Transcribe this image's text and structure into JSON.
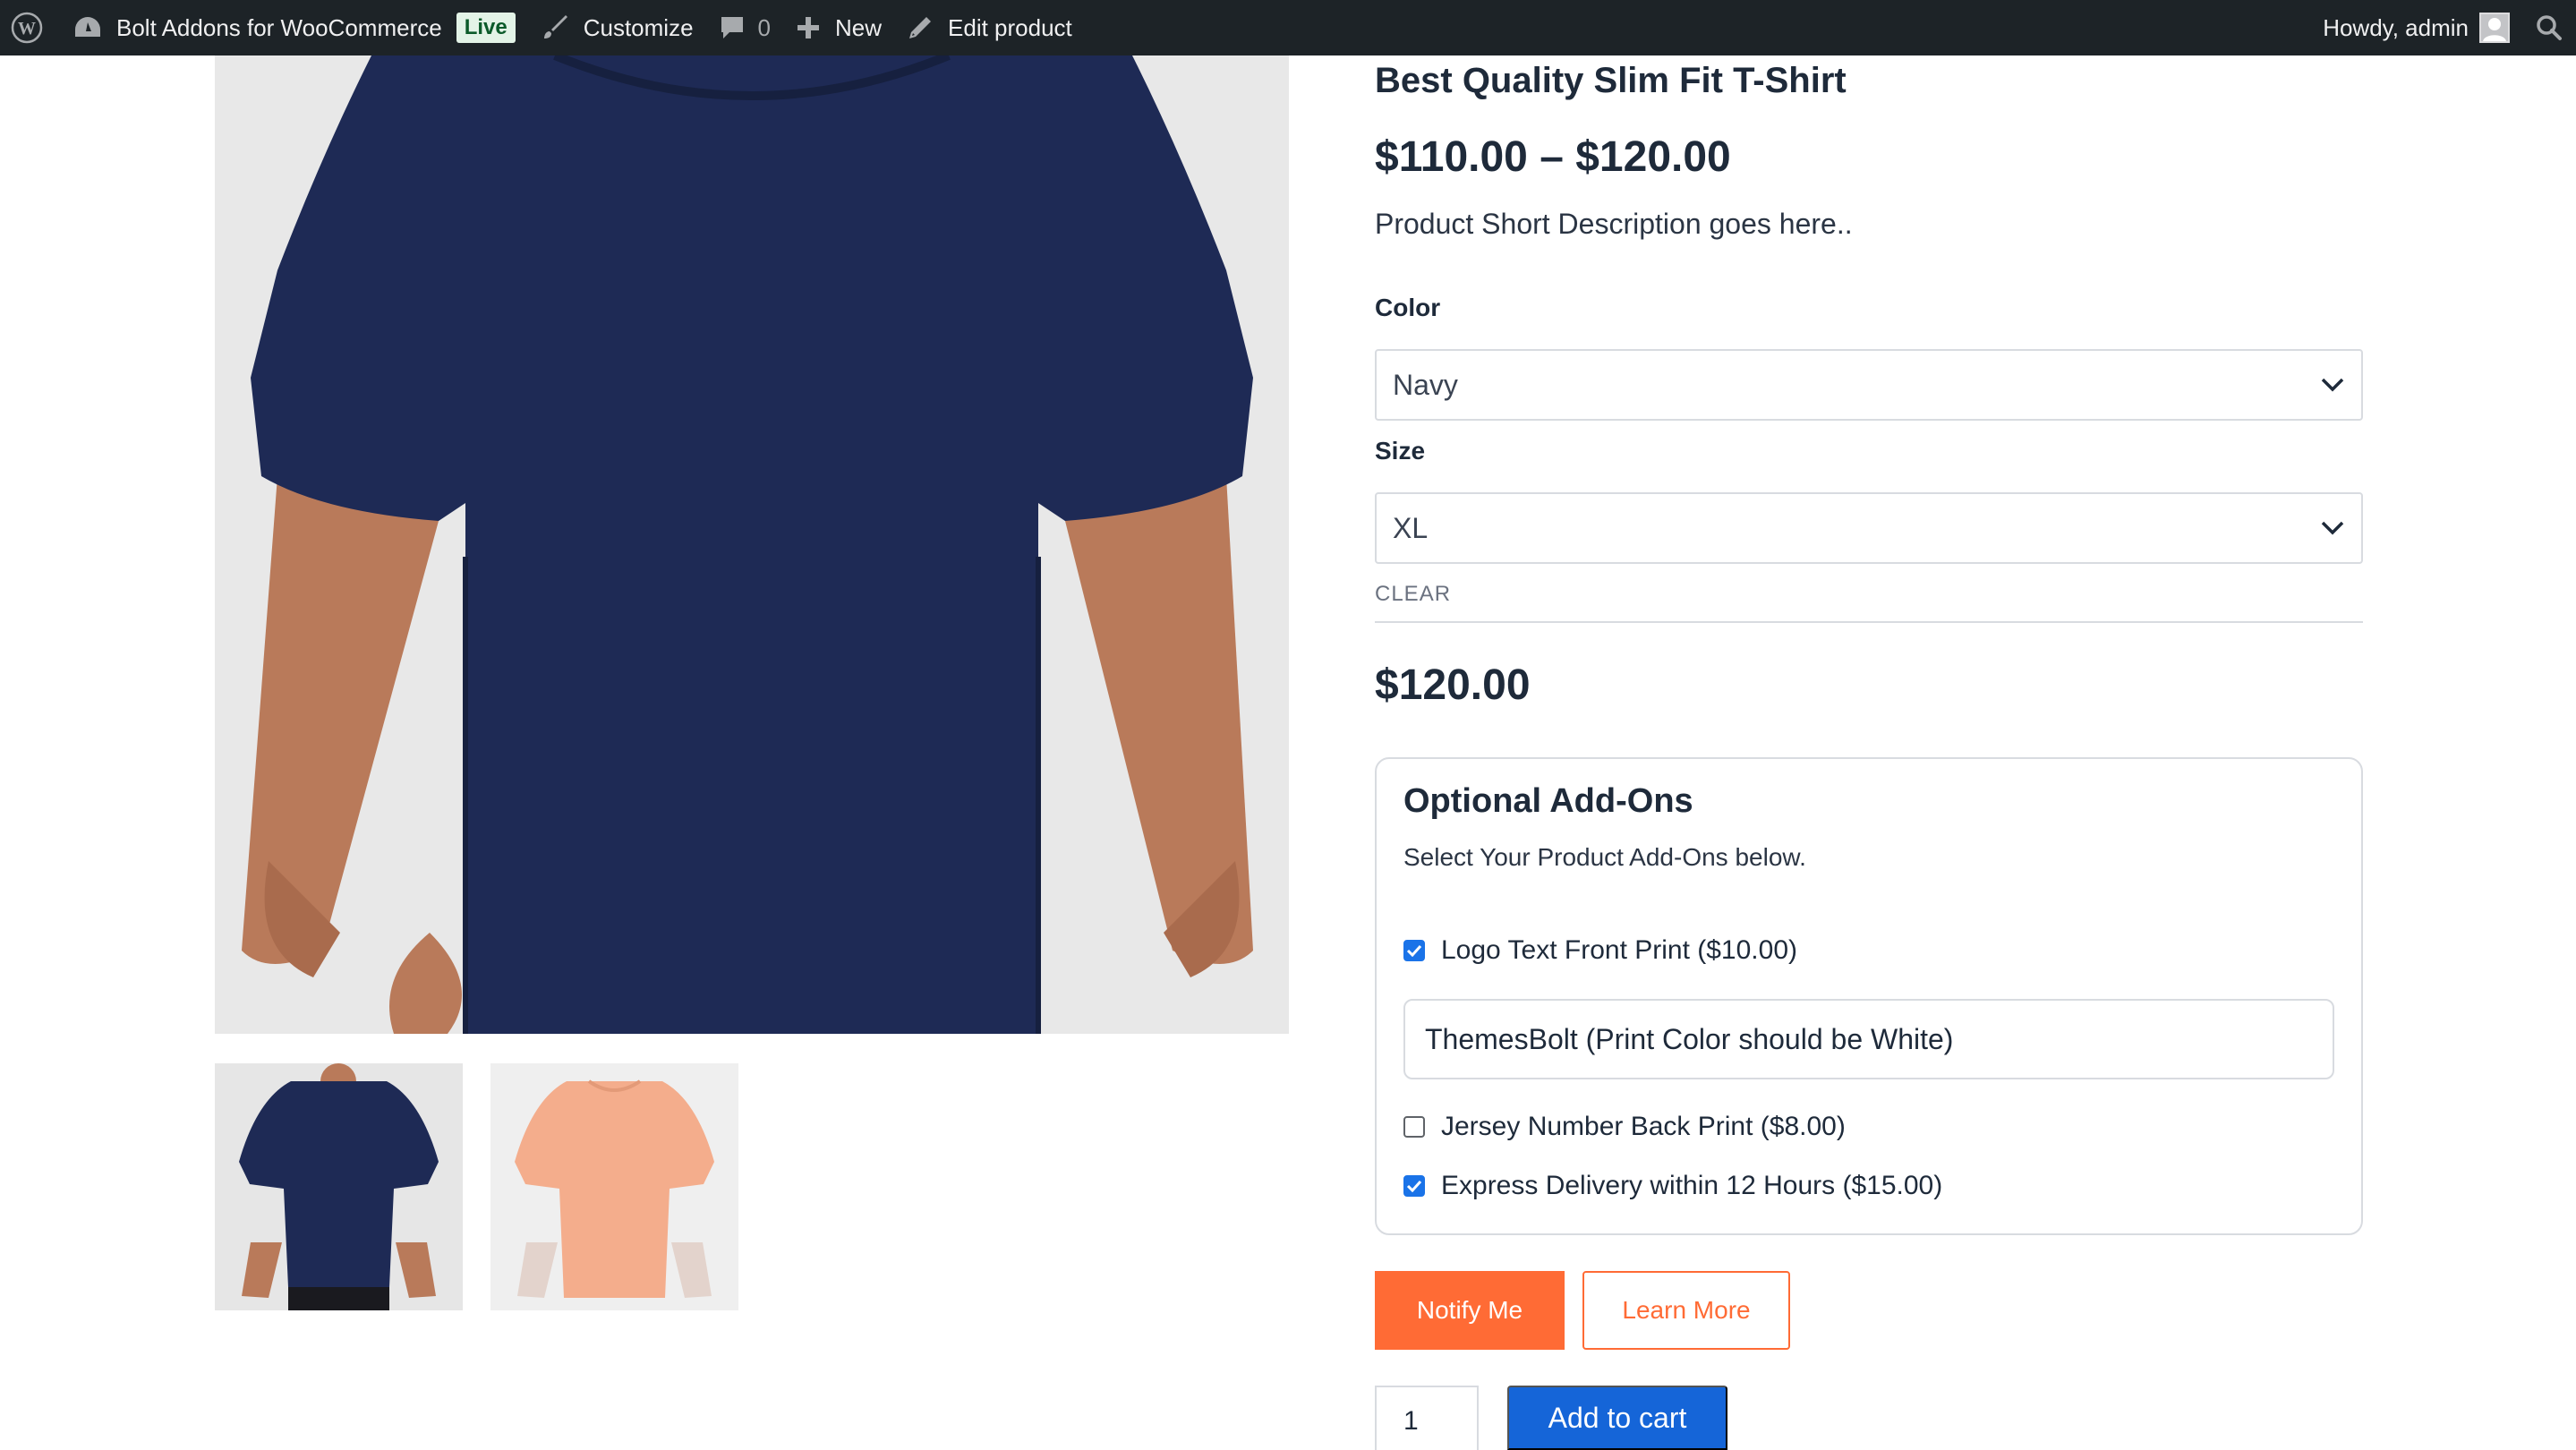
{
  "admin_bar": {
    "site_name": "Bolt Addons for WooCommerce",
    "live_badge": "Live",
    "customize": "Customize",
    "comments_count": "0",
    "new": "New",
    "edit_product": "Edit product",
    "howdy": "Howdy, admin",
    "icons": [
      "wordpress-logo-icon",
      "dashboard-icon",
      "paintbrush-icon",
      "comment-icon",
      "plus-icon",
      "pencil-icon",
      "avatar",
      "search-icon"
    ]
  },
  "gallery": {
    "thumbnails": [
      {
        "color": "navy"
      },
      {
        "color": "peach"
      }
    ]
  },
  "product": {
    "title": "Best Quality Slim Fit T-Shirt",
    "price_range": "$110.00 – $120.00",
    "short_description": "Product Short Description goes here..",
    "color_label": "Color",
    "color_value": "Navy",
    "size_label": "Size",
    "size_value": "XL",
    "clear": "CLEAR",
    "variation_price": "$120.00"
  },
  "addons": {
    "title": "Optional Add-Ons",
    "description": "Select Your Product Add-Ons below.",
    "items": [
      {
        "label": "Logo Text Front Print ($10.00)",
        "checked": true
      },
      {
        "label": "Jersey Number Back Print ($8.00)",
        "checked": false
      },
      {
        "label": "Express Delivery within 12 Hours ($15.00)",
        "checked": true
      }
    ],
    "text_value": "ThemesBolt (Print Color should be White)"
  },
  "actions": {
    "notify": "Notify Me",
    "learn_more": "Learn More",
    "quantity": "1",
    "add_to_cart": "Add to cart"
  },
  "colors": {
    "admin_bar": "#1d2327",
    "accent_orange": "#ff6b35",
    "cart_blue": "#1565d8",
    "checkbox_blue": "#1a73e8",
    "shirt_navy": "#1e2a55",
    "shirt_peach": "#f4ad8c"
  }
}
